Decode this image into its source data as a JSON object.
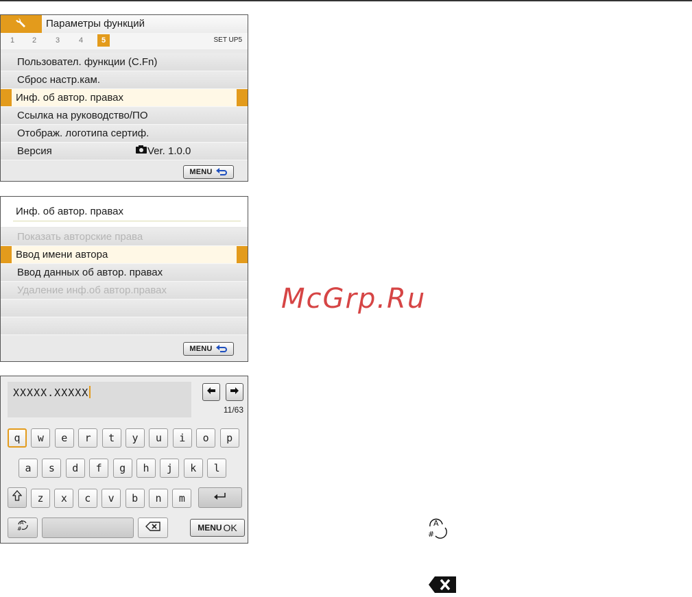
{
  "screen1": {
    "title": "Параметры функций",
    "tabs": [
      "1",
      "2",
      "3",
      "4",
      "5"
    ],
    "active_tab": "5",
    "tab_group_label": "SET UP5",
    "items": [
      {
        "label": "Пользовател. функции (C.Fn)"
      },
      {
        "label": "Сброс настр.кам."
      },
      {
        "label": "Инф. об автор. правах",
        "selected": true
      },
      {
        "label": "Ссылка на руководство/ПО"
      },
      {
        "label": "Отображ. логотипа сертиф."
      },
      {
        "label": "Версия",
        "value": "Ver. 1.0.0"
      }
    ],
    "menu_button": "MENU"
  },
  "screen2": {
    "heading": "Инф. об автор. правах",
    "items": [
      {
        "label": "Показать авторские права",
        "disabled": true
      },
      {
        "label": "Ввод имени автора",
        "selected": true
      },
      {
        "label": "Ввод данных об автор. правах"
      },
      {
        "label": "Удаление инф.об автор.правах",
        "disabled": true
      }
    ],
    "menu_button": "MENU"
  },
  "screen3": {
    "text_value": "XXXXX.XXXXX",
    "counter": "11/63",
    "rows": [
      [
        "q",
        "w",
        "e",
        "r",
        "t",
        "y",
        "u",
        "i",
        "o",
        "p"
      ],
      [
        "a",
        "s",
        "d",
        "f",
        "g",
        "h",
        "j",
        "k",
        "l"
      ],
      [
        "z",
        "x",
        "c",
        "v",
        "b",
        "n",
        "m"
      ]
    ],
    "focused_key": "q",
    "ok_menu_label": "MENU",
    "ok_label": "OK"
  },
  "watermark": "McGrp.Ru",
  "colors": {
    "accent": "#e39b1c",
    "selected_row": "#fff8e6",
    "menu_bg": "#e6e6e6",
    "watermark": "#d64545"
  },
  "icons": {
    "tab_icon": "wrench-icon",
    "camera": "camera-icon",
    "return": "return-arrow-icon",
    "left": "arrow-left-icon",
    "right": "arrow-right-icon",
    "shift": "shift-icon",
    "enter": "enter-icon",
    "mode": "input-mode-icon",
    "backspace": "backspace-icon"
  }
}
